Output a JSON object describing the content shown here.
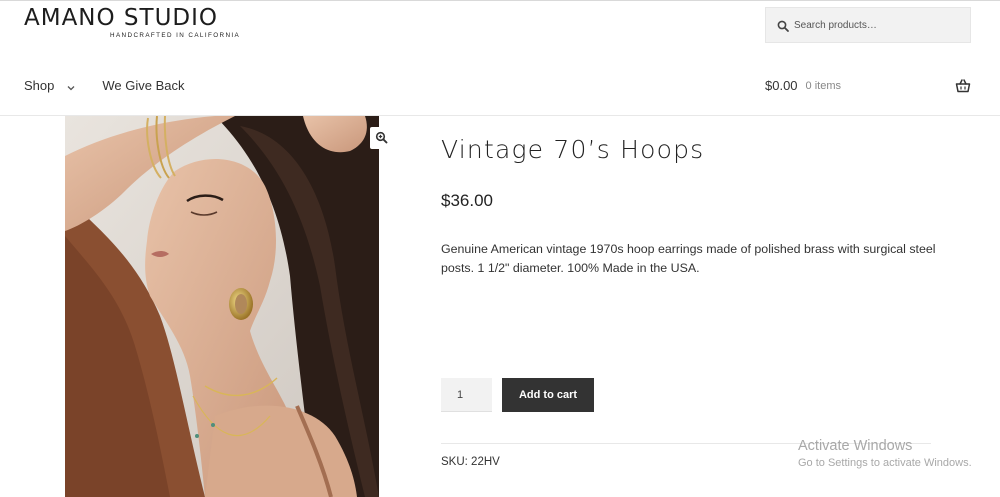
{
  "brand": {
    "name": "AMANO STUDIO",
    "tagline": "HANDCRAFTED IN CALIFORNIA"
  },
  "search": {
    "placeholder": "Search products…",
    "icon": "search-icon"
  },
  "nav": {
    "items": [
      {
        "label": "Shop",
        "has_dropdown": true
      },
      {
        "label": "We Give Back",
        "has_dropdown": false
      }
    ]
  },
  "cart": {
    "total": "$0.00",
    "count_label": "0 items",
    "icon": "basket-icon"
  },
  "product": {
    "title": "Vintage 70’s Hoops",
    "price": "$36.00",
    "description": "Genuine American vintage 1970s hoop earrings made of polished brass with surgical steel posts. 1 1/2\" diameter. 100% Made in the USA.",
    "quantity": "1",
    "add_to_cart_label": "Add to cart",
    "sku_label": "SKU:",
    "sku_value": "22HV",
    "zoom_icon": "zoom-in-icon"
  },
  "os_watermark": {
    "title": "Activate Windows",
    "subtitle": "Go to Settings to activate Windows."
  },
  "colors": {
    "button_dark": "#333333",
    "input_bg": "#f2f2f2",
    "text": "#333333"
  }
}
